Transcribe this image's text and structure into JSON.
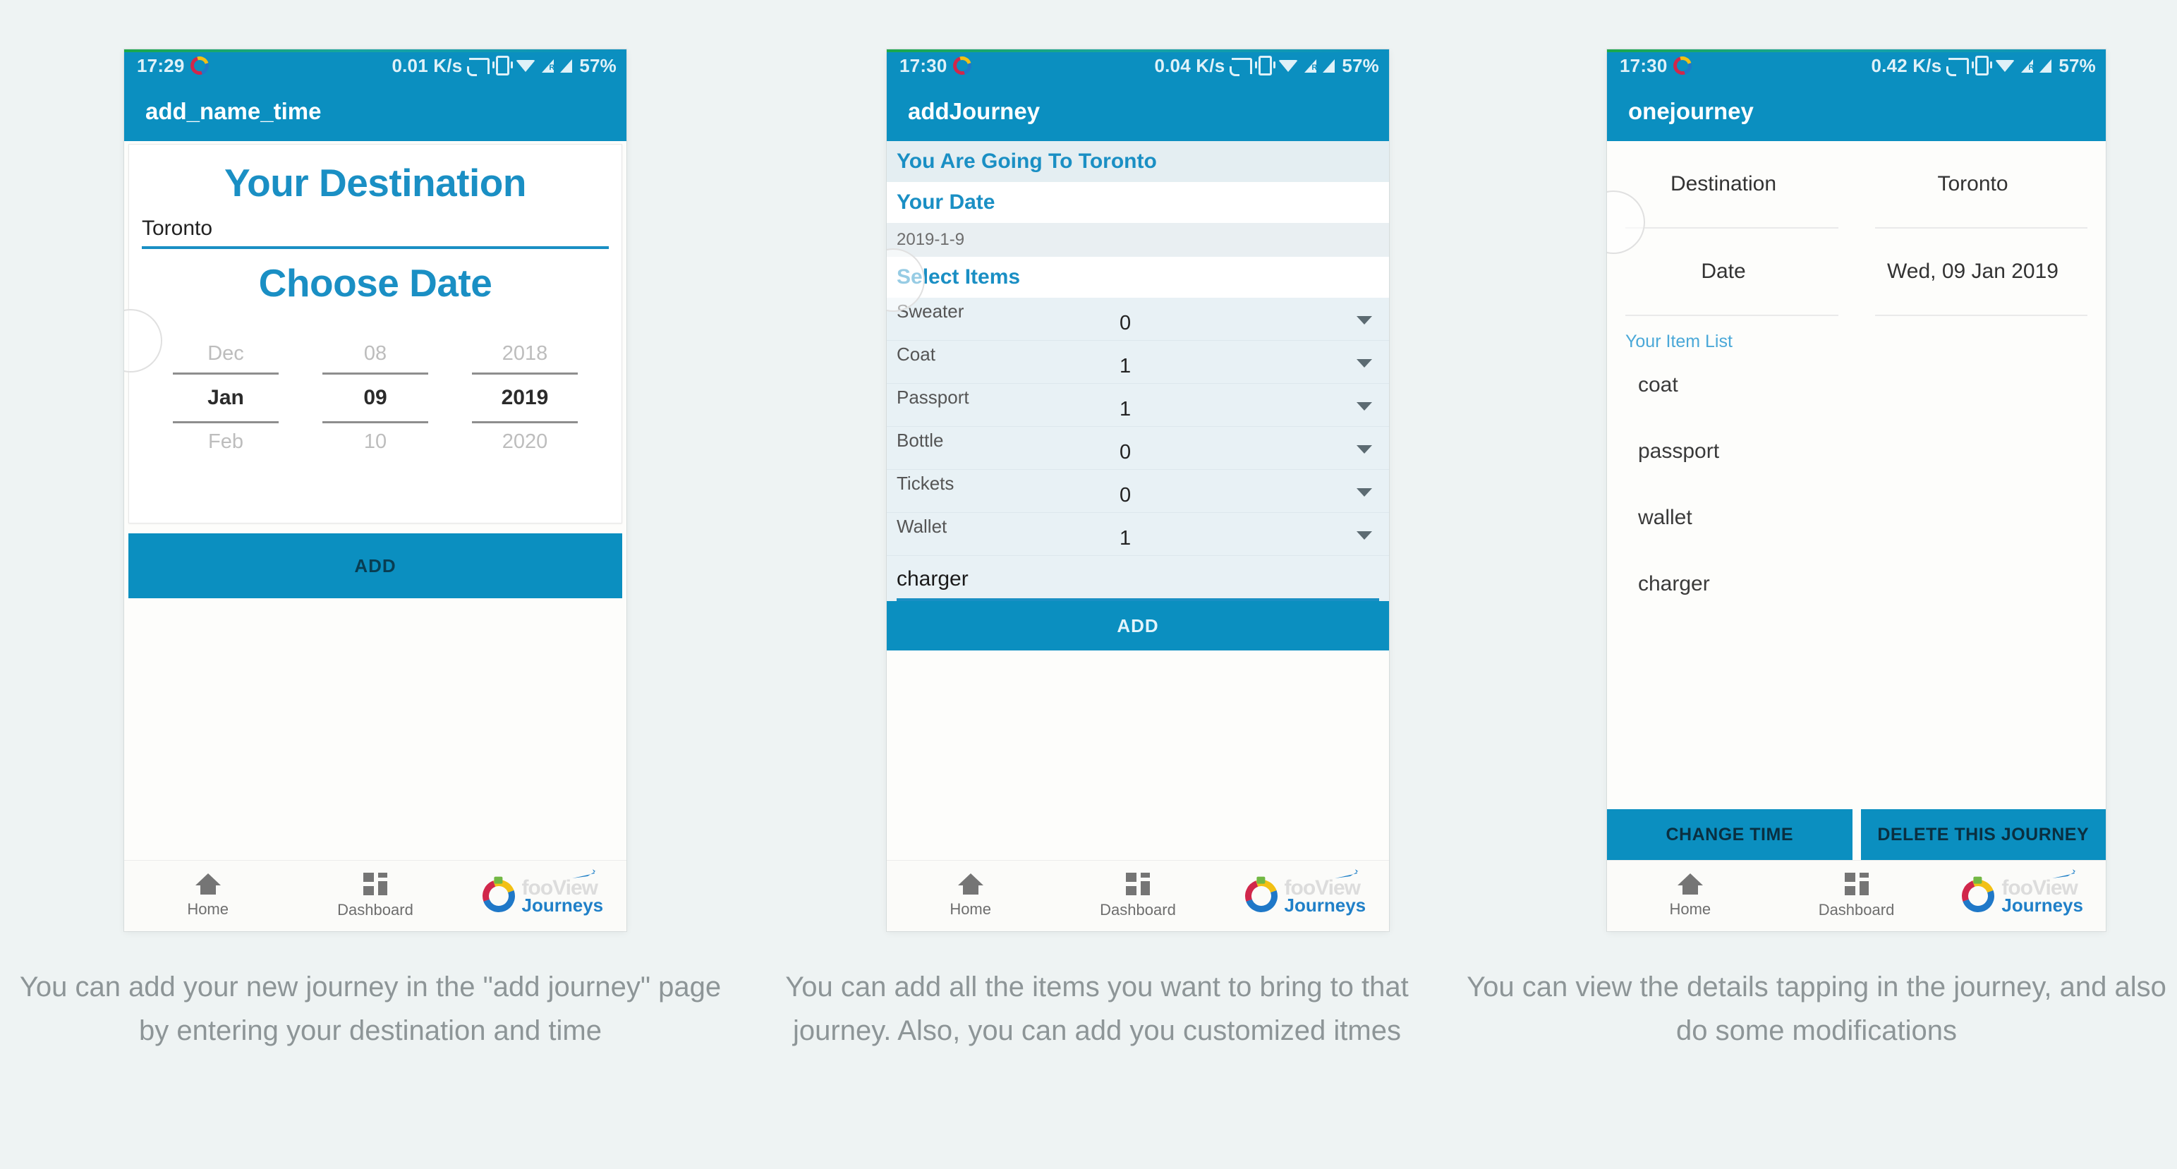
{
  "page": {
    "background_color": "#eef3f3",
    "accent_color": "#0b8fc0",
    "heading_color": "#1a8fc4"
  },
  "brand": {
    "name_top": "fooView",
    "name_bottom": "Journeys"
  },
  "bottom_nav": {
    "home_label": "Home",
    "dashboard_label": "Dashboard"
  },
  "screens": [
    {
      "status_bar": {
        "time": "17:29",
        "data_rate": "0.01 K/s",
        "battery": "57%",
        "roaming_letter": "R"
      },
      "app_bar": {
        "title": "add_name_time"
      },
      "destination": {
        "heading": "Your Destination",
        "value": "Toronto"
      },
      "date": {
        "heading": "Choose Date",
        "picker": {
          "month": {
            "prev": "Dec",
            "selected": "Jan",
            "next": "Feb"
          },
          "day": {
            "prev": "08",
            "selected": "09",
            "next": "10"
          },
          "year": {
            "prev": "2018",
            "selected": "2019",
            "next": "2020"
          }
        }
      },
      "add_button": "ADD"
    },
    {
      "status_bar": {
        "time": "17:30",
        "data_rate": "0.04 K/s",
        "battery": "57%",
        "roaming_letter": "R"
      },
      "app_bar": {
        "title": "addJourney"
      },
      "destination_banner": "You Are Going To Toronto",
      "date_heading": "Your Date",
      "date_value": "2019-1-9",
      "items_heading": "Select Items",
      "items": [
        {
          "name": "Sweater",
          "qty": "0"
        },
        {
          "name": "Coat",
          "qty": "1"
        },
        {
          "name": "Passport",
          "qty": "1"
        },
        {
          "name": "Bottle",
          "qty": "0"
        },
        {
          "name": "Tickets",
          "qty": "0"
        },
        {
          "name": "Wallet",
          "qty": "1"
        }
      ],
      "custom_item_value": "charger",
      "add_button": "ADD"
    },
    {
      "status_bar": {
        "time": "17:30",
        "data_rate": "0.42 K/s",
        "battery": "57%",
        "roaming_letter": "R"
      },
      "app_bar": {
        "title": "onejourney"
      },
      "details": [
        {
          "key": "Destination",
          "value": "Toronto"
        },
        {
          "key": "Date",
          "value": "Wed, 09 Jan 2019"
        }
      ],
      "item_list_heading": "Your Item List",
      "item_list": [
        "coat",
        "passport",
        "wallet",
        "charger"
      ],
      "change_time_button": "CHANGE TIME",
      "delete_button": "DELETE THIS JOURNEY"
    }
  ],
  "captions": [
    "You can add your new journey in the \"add journey\" page by entering your destination and time",
    "You can add all the items you want to bring to that journey. Also, you can add you customized itmes",
    "You can view the details tapping in the journey, and also do some modifications"
  ]
}
